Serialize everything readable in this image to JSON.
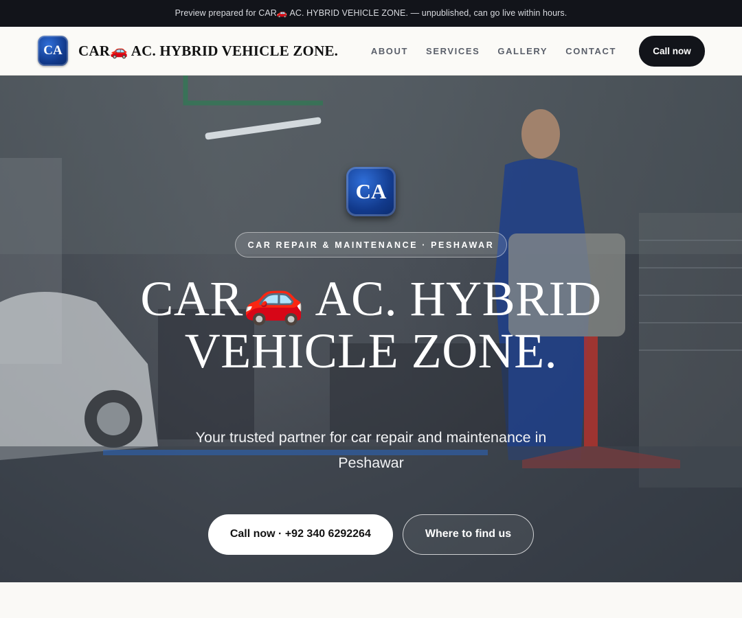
{
  "preview_banner": {
    "text": "Preview prepared for CAR🚗 AC. HYBRID VEHICLE ZONE. — unpublished, can go live within hours."
  },
  "header": {
    "logo_initials": "CA",
    "brand_name": "CAR🚗 AC. HYBRID VEHICLE ZONE.",
    "nav": [
      "ABOUT",
      "SERVICES",
      "GALLERY",
      "CONTACT"
    ],
    "call_label": "Call now"
  },
  "hero": {
    "logo_initials": "CA",
    "tagline": "CAR REPAIR & MAINTENANCE · PESHAWAR",
    "title": "CAR🚗 AC. HYBRID VEHICLE ZONE.",
    "subtitle": "Your trusted partner for car repair and maintenance in Peshawar",
    "primary_button": "Call now · +92 340 6292264",
    "secondary_button": "Where to find us"
  },
  "colors": {
    "dark": "#12141a",
    "logo_blue": "#123a8c",
    "page_bg": "#faf9f6"
  },
  "icons": {
    "logo": "ca-monogram-logo",
    "brand_car": "red-car-emoji"
  }
}
